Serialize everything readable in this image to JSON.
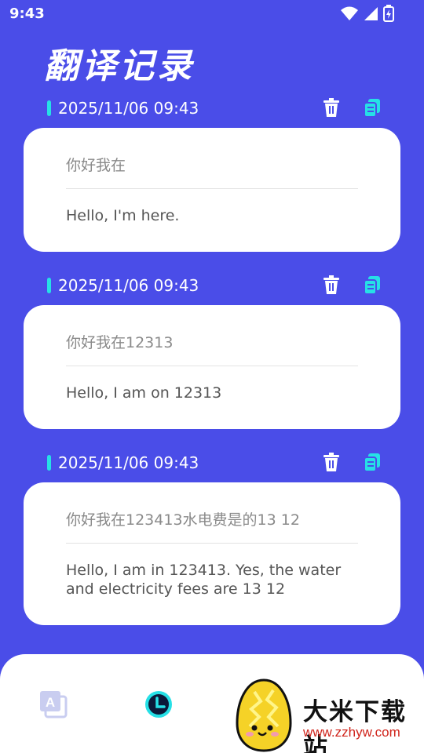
{
  "status_bar": {
    "time": "9:43"
  },
  "page": {
    "title": "翻译记录"
  },
  "records": [
    {
      "date": "2025/11/06 09:43",
      "source": "你好我在",
      "target": "Hello, I'm here."
    },
    {
      "date": "2025/11/06 09:43",
      "source": "你好我在12313",
      "target": "Hello, I am on 12313"
    },
    {
      "date": "2025/11/06 09:43",
      "source": "你好我在123413水电费是的13 12",
      "target": "Hello, I am in 123413. Yes, the water and electricity fees are 13 12"
    }
  ],
  "icons": {
    "delete": "trash-icon",
    "copy": "copy-icon",
    "nav_translate": "translate-icon",
    "nav_history": "clock-icon"
  },
  "watermark": {
    "text": "大米下载站",
    "url": "www.zzhyw.com"
  },
  "colors": {
    "background": "#4a4de8",
    "accent": "#26e0e6",
    "card": "#ffffff"
  }
}
